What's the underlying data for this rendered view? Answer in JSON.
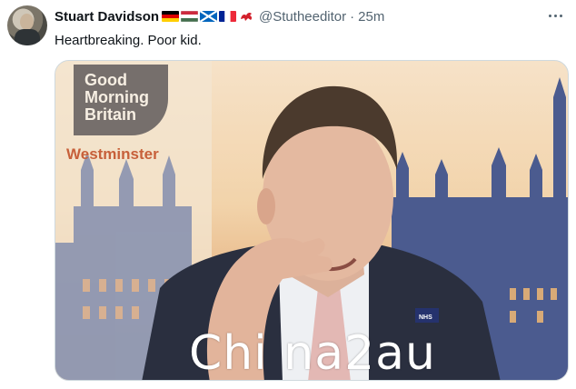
{
  "tweet": {
    "author_name": "Stuart Davidson",
    "flags": [
      "germany-flag",
      "hungary-flag",
      "scotland-flag",
      "france-flag",
      "wales-dragon"
    ],
    "handle": "@Stutheeditor",
    "separator": "·",
    "time": "25m",
    "text": "Heartbreaking. Poor kid."
  },
  "media": {
    "logo_lines": [
      "Good",
      "Morning",
      "Britain"
    ],
    "location": "Westminster",
    "badge": "NHS",
    "watermark": "Chi na2au"
  },
  "colors": {
    "name": "#0f1419",
    "secondary": "#536471",
    "westminster": "#c7603a",
    "logo_bg": "#6f6866"
  }
}
